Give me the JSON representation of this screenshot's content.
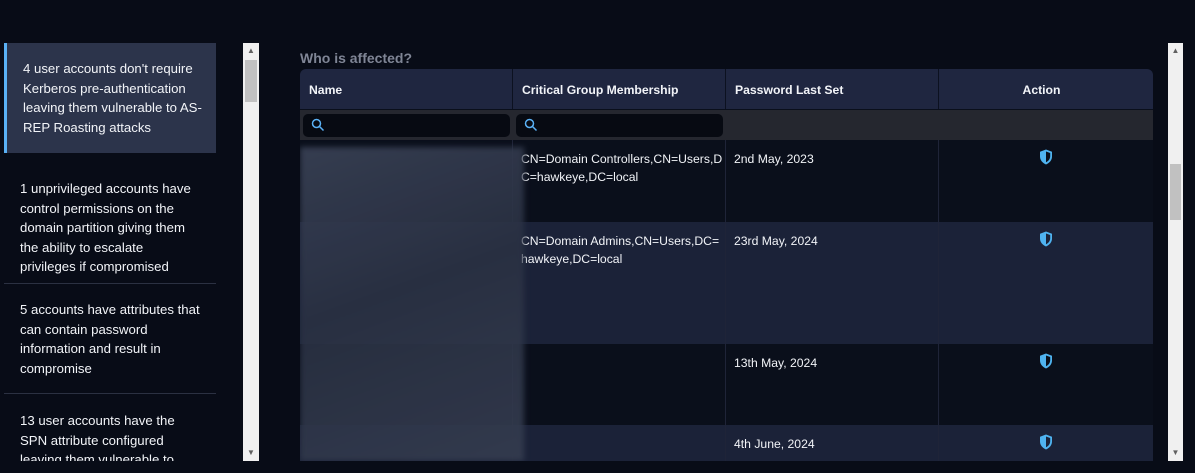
{
  "findings": [
    {
      "text": "4 user accounts don't require Kerberos pre-authentication leaving them vulnerable to AS-REP Roasting attacks",
      "active": true
    },
    {
      "text": "1 unprivileged accounts have control permissions on the domain partition giving them the ability to escalate privileges if compromised",
      "active": false
    },
    {
      "text": "5 accounts have attributes that can contain password information and result in compromise",
      "active": false
    },
    {
      "text": "13 user accounts have the SPN attribute configured leaving them vulnerable to",
      "active": false
    }
  ],
  "section_title": "Who is affected?",
  "table": {
    "headers": {
      "name": "Name",
      "group": "Critical Group Membership",
      "password": "Password Last Set",
      "action": "Action"
    },
    "filters": {
      "name_placeholder": "",
      "group_placeholder": ""
    },
    "rows": [
      {
        "name": "",
        "group": "CN=Domain Controllers,CN=Users,DC=hawkeye,DC=local",
        "password_last_set": "2nd May, 2023",
        "action_icon": "shield-icon"
      },
      {
        "name": "",
        "group": "CN=Domain Admins,CN=Users,DC=hawkeye,DC=local",
        "password_last_set": "23rd May, 2024",
        "action_icon": "shield-icon"
      },
      {
        "name": "",
        "group": "",
        "password_last_set": "13th May, 2024",
        "action_icon": "shield-icon"
      },
      {
        "name": "",
        "group": "",
        "password_last_set": "4th June, 2024",
        "action_icon": "shield-icon"
      }
    ]
  },
  "colors": {
    "background": "#080c17",
    "active_finding": "#2c344b",
    "accent": "#5ab1f5",
    "header": "#1f2640",
    "row_alt": "#1b2238",
    "shield": "#4fb3f0"
  }
}
